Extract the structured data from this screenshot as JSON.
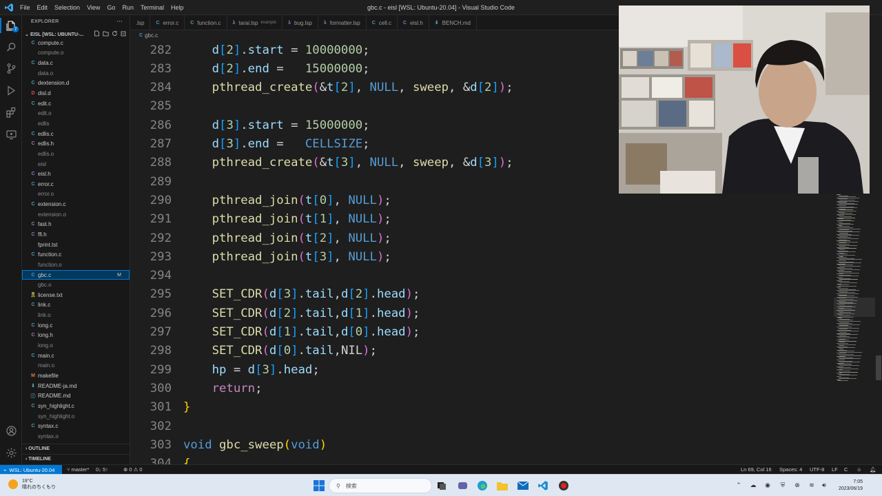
{
  "window": {
    "title": "gbc.c - eisl [WSL: Ubuntu-20.04] - Visual Studio Code",
    "menu": [
      "File",
      "Edit",
      "Selection",
      "View",
      "Go",
      "Run",
      "Terminal",
      "Help"
    ]
  },
  "activity": {
    "source_control_badge": "7"
  },
  "explorer": {
    "title": "EXPLORER",
    "more": "···",
    "folder": "EISL [WSL: UBUNTU-...",
    "files": [
      {
        "icon": "C",
        "name": "compute.c",
        "dim": false,
        "color": "#519aba"
      },
      {
        "icon": "",
        "name": "compute.o",
        "dim": true,
        "color": "#8b8b8b"
      },
      {
        "icon": "C",
        "name": "data.c",
        "dim": false,
        "color": "#519aba"
      },
      {
        "icon": "",
        "name": "data.o",
        "dim": true,
        "color": "#8b8b8b"
      },
      {
        "icon": "C",
        "name": "dextension.d",
        "dim": false,
        "color": "#519aba"
      },
      {
        "icon": "D",
        "name": "disl.d",
        "dim": false,
        "color": "#e04c4c"
      },
      {
        "icon": "C",
        "name": "edit.c",
        "dim": false,
        "color": "#519aba"
      },
      {
        "icon": "",
        "name": "edit.o",
        "dim": true,
        "color": "#8b8b8b"
      },
      {
        "icon": "",
        "name": "edlis",
        "dim": true,
        "color": "#8b8b8b"
      },
      {
        "icon": "C",
        "name": "edlis.c",
        "dim": false,
        "color": "#519aba"
      },
      {
        "icon": "C",
        "name": "edlis.h",
        "dim": false,
        "color": "#a074c4"
      },
      {
        "icon": "",
        "name": "edlis.o",
        "dim": true,
        "color": "#8b8b8b"
      },
      {
        "icon": "",
        "name": "eisl",
        "dim": true,
        "color": "#8b8b8b"
      },
      {
        "icon": "C",
        "name": "eisl.h",
        "dim": false,
        "color": "#a074c4"
      },
      {
        "icon": "C",
        "name": "error.c",
        "dim": false,
        "color": "#519aba"
      },
      {
        "icon": "",
        "name": "error.o",
        "dim": true,
        "color": "#8b8b8b"
      },
      {
        "icon": "C",
        "name": "extension.c",
        "dim": false,
        "color": "#519aba"
      },
      {
        "icon": "",
        "name": "extension.o",
        "dim": true,
        "color": "#8b8b8b"
      },
      {
        "icon": "C",
        "name": "fast.h",
        "dim": false,
        "color": "#a074c4"
      },
      {
        "icon": "C",
        "name": "ffi.h",
        "dim": false,
        "color": "#a074c4"
      },
      {
        "icon": "",
        "name": "fprint.tst",
        "dim": false,
        "color": "#8b8b8b"
      },
      {
        "icon": "C",
        "name": "function.c",
        "dim": false,
        "color": "#519aba"
      },
      {
        "icon": "",
        "name": "function.o",
        "dim": true,
        "color": "#8b8b8b"
      },
      {
        "icon": "C",
        "name": "gbc.c",
        "dim": false,
        "color": "#519aba",
        "selected": true,
        "status": "M"
      },
      {
        "icon": "",
        "name": "gbc.o",
        "dim": true,
        "color": "#8b8b8b"
      },
      {
        "icon": "🎗",
        "name": "license.txt",
        "dim": false,
        "color": "#cbcb41"
      },
      {
        "icon": "C",
        "name": "link.c",
        "dim": false,
        "color": "#519aba"
      },
      {
        "icon": "",
        "name": "link.o",
        "dim": true,
        "color": "#8b8b8b"
      },
      {
        "icon": "C",
        "name": "long.c",
        "dim": false,
        "color": "#519aba"
      },
      {
        "icon": "C",
        "name": "long.h",
        "dim": false,
        "color": "#a074c4"
      },
      {
        "icon": "",
        "name": "long.o",
        "dim": true,
        "color": "#8b8b8b"
      },
      {
        "icon": "C",
        "name": "main.c",
        "dim": false,
        "color": "#519aba"
      },
      {
        "icon": "",
        "name": "main.o",
        "dim": true,
        "color": "#8b8b8b"
      },
      {
        "icon": "M",
        "name": "makefile",
        "dim": false,
        "color": "#e37933"
      },
      {
        "icon": "⬇",
        "name": "README-ja.md",
        "dim": false,
        "color": "#519aba"
      },
      {
        "icon": "ⓘ",
        "name": "README.md",
        "dim": false,
        "color": "#519aba"
      },
      {
        "icon": "C",
        "name": "syn_highlight.c",
        "dim": false,
        "color": "#519aba"
      },
      {
        "icon": "",
        "name": "syn_highlight.o",
        "dim": true,
        "color": "#8b8b8b"
      },
      {
        "icon": "C",
        "name": "syntax.c",
        "dim": false,
        "color": "#519aba"
      },
      {
        "icon": "",
        "name": "syntax.o",
        "dim": true,
        "color": "#8b8b8b"
      }
    ],
    "outline": "OUTLINE",
    "timeline": "TIMELINE"
  },
  "tabs": [
    {
      "icon": "",
      "label": ".lsp",
      "hint": "",
      "color": "#9d9d9d"
    },
    {
      "icon": "C",
      "label": "error.c",
      "hint": "",
      "color": "#519aba"
    },
    {
      "icon": "C",
      "label": "function.c",
      "hint": "",
      "color": "#519aba"
    },
    {
      "icon": "λ",
      "label": "tarai.lsp",
      "hint": "example",
      "color": "#a074c4"
    },
    {
      "icon": "λ",
      "label": "bug.lsp",
      "hint": "",
      "color": "#a074c4"
    },
    {
      "icon": "λ",
      "label": "formatter.lsp",
      "hint": "",
      "color": "#a074c4"
    },
    {
      "icon": "C",
      "label": "cell.c",
      "hint": "",
      "color": "#519aba"
    },
    {
      "icon": "C",
      "label": "eisl.h",
      "hint": "",
      "color": "#a074c4"
    },
    {
      "icon": "⬇",
      "label": "BENCH.md",
      "hint": "",
      "color": "#519aba"
    }
  ],
  "breadcrumb": {
    "icon": "C",
    "file": "gbc.c"
  },
  "code": [
    {
      "n": "282",
      "tokens": [
        [
          "    ",
          "id"
        ],
        [
          "d",
          "var"
        ],
        [
          "[",
          "br2"
        ],
        [
          "2",
          "num"
        ],
        [
          "]",
          "br2"
        ],
        [
          ".",
          "op"
        ],
        [
          "start",
          "var"
        ],
        [
          " = ",
          "op"
        ],
        [
          "10000000",
          "num"
        ],
        [
          ";",
          "op"
        ]
      ]
    },
    {
      "n": "283",
      "tokens": [
        [
          "    ",
          "id"
        ],
        [
          "d",
          "var"
        ],
        [
          "[",
          "br2"
        ],
        [
          "2",
          "num"
        ],
        [
          "]",
          "br2"
        ],
        [
          ".",
          "op"
        ],
        [
          "end",
          "var"
        ],
        [
          " =   ",
          "op"
        ],
        [
          "15000000",
          "num"
        ],
        [
          ";",
          "op"
        ]
      ]
    },
    {
      "n": "284",
      "tokens": [
        [
          "    ",
          "id"
        ],
        [
          "pthread_create",
          "fn"
        ],
        [
          "(",
          "br1"
        ],
        [
          "&",
          "op"
        ],
        [
          "t",
          "var"
        ],
        [
          "[",
          "br2"
        ],
        [
          "2",
          "num"
        ],
        [
          "]",
          "br2"
        ],
        [
          ", ",
          "op"
        ],
        [
          "NULL",
          "con"
        ],
        [
          ", ",
          "op"
        ],
        [
          "sweep",
          "fn"
        ],
        [
          ", &",
          "op"
        ],
        [
          "d",
          "var"
        ],
        [
          "[",
          "br2"
        ],
        [
          "2",
          "num"
        ],
        [
          "]",
          "br2"
        ],
        [
          ")",
          "br1"
        ],
        [
          ";",
          "op"
        ]
      ]
    },
    {
      "n": "285",
      "tokens": []
    },
    {
      "n": "286",
      "tokens": [
        [
          "    ",
          "id"
        ],
        [
          "d",
          "var"
        ],
        [
          "[",
          "br2"
        ],
        [
          "3",
          "num"
        ],
        [
          "]",
          "br2"
        ],
        [
          ".",
          "op"
        ],
        [
          "start",
          "var"
        ],
        [
          " = ",
          "op"
        ],
        [
          "15000000",
          "num"
        ],
        [
          ";",
          "op"
        ]
      ]
    },
    {
      "n": "287",
      "tokens": [
        [
          "    ",
          "id"
        ],
        [
          "d",
          "var"
        ],
        [
          "[",
          "br2"
        ],
        [
          "3",
          "num"
        ],
        [
          "]",
          "br2"
        ],
        [
          ".",
          "op"
        ],
        [
          "end",
          "var"
        ],
        [
          " =   ",
          "op"
        ],
        [
          "CELLSIZE",
          "con"
        ],
        [
          ";",
          "op"
        ]
      ]
    },
    {
      "n": "288",
      "tokens": [
        [
          "    ",
          "id"
        ],
        [
          "pthread_create",
          "fn"
        ],
        [
          "(",
          "br1"
        ],
        [
          "&",
          "op"
        ],
        [
          "t",
          "var"
        ],
        [
          "[",
          "br2"
        ],
        [
          "3",
          "num"
        ],
        [
          "]",
          "br2"
        ],
        [
          ", ",
          "op"
        ],
        [
          "NULL",
          "con"
        ],
        [
          ", ",
          "op"
        ],
        [
          "sweep",
          "fn"
        ],
        [
          ", &",
          "op"
        ],
        [
          "d",
          "var"
        ],
        [
          "[",
          "br2"
        ],
        [
          "3",
          "num"
        ],
        [
          "]",
          "br2"
        ],
        [
          ")",
          "br1"
        ],
        [
          ";",
          "op"
        ]
      ]
    },
    {
      "n": "289",
      "tokens": []
    },
    {
      "n": "290",
      "tokens": [
        [
          "    ",
          "id"
        ],
        [
          "pthread_join",
          "fn"
        ],
        [
          "(",
          "br1"
        ],
        [
          "t",
          "var"
        ],
        [
          "[",
          "br2"
        ],
        [
          "0",
          "num"
        ],
        [
          "]",
          "br2"
        ],
        [
          ", ",
          "op"
        ],
        [
          "NULL",
          "con"
        ],
        [
          ")",
          "br1"
        ],
        [
          ";",
          "op"
        ]
      ]
    },
    {
      "n": "291",
      "tokens": [
        [
          "    ",
          "id"
        ],
        [
          "pthread_join",
          "fn"
        ],
        [
          "(",
          "br1"
        ],
        [
          "t",
          "var"
        ],
        [
          "[",
          "br2"
        ],
        [
          "1",
          "num"
        ],
        [
          "]",
          "br2"
        ],
        [
          ", ",
          "op"
        ],
        [
          "NULL",
          "con"
        ],
        [
          ")",
          "br1"
        ],
        [
          ";",
          "op"
        ]
      ]
    },
    {
      "n": "292",
      "tokens": [
        [
          "    ",
          "id"
        ],
        [
          "pthread_join",
          "fn"
        ],
        [
          "(",
          "br1"
        ],
        [
          "t",
          "var"
        ],
        [
          "[",
          "br2"
        ],
        [
          "2",
          "num"
        ],
        [
          "]",
          "br2"
        ],
        [
          ", ",
          "op"
        ],
        [
          "NULL",
          "con"
        ],
        [
          ")",
          "br1"
        ],
        [
          ";",
          "op"
        ]
      ]
    },
    {
      "n": "293",
      "tokens": [
        [
          "    ",
          "id"
        ],
        [
          "pthread_join",
          "fn"
        ],
        [
          "(",
          "br1"
        ],
        [
          "t",
          "var"
        ],
        [
          "[",
          "br2"
        ],
        [
          "3",
          "num"
        ],
        [
          "]",
          "br2"
        ],
        [
          ", ",
          "op"
        ],
        [
          "NULL",
          "con"
        ],
        [
          ")",
          "br1"
        ],
        [
          ";",
          "op"
        ]
      ]
    },
    {
      "n": "294",
      "tokens": []
    },
    {
      "n": "295",
      "tokens": [
        [
          "    ",
          "id"
        ],
        [
          "SET_CDR",
          "fn"
        ],
        [
          "(",
          "br1"
        ],
        [
          "d",
          "var"
        ],
        [
          "[",
          "br2"
        ],
        [
          "3",
          "num"
        ],
        [
          "]",
          "br2"
        ],
        [
          ".",
          "op"
        ],
        [
          "tail",
          "var"
        ],
        [
          ",",
          "op"
        ],
        [
          "d",
          "var"
        ],
        [
          "[",
          "br2"
        ],
        [
          "2",
          "num"
        ],
        [
          "]",
          "br2"
        ],
        [
          ".",
          "op"
        ],
        [
          "head",
          "var"
        ],
        [
          ")",
          "br1"
        ],
        [
          ";",
          "op"
        ]
      ]
    },
    {
      "n": "296",
      "tokens": [
        [
          "    ",
          "id"
        ],
        [
          "SET_CDR",
          "fn"
        ],
        [
          "(",
          "br1"
        ],
        [
          "d",
          "var"
        ],
        [
          "[",
          "br2"
        ],
        [
          "2",
          "num"
        ],
        [
          "]",
          "br2"
        ],
        [
          ".",
          "op"
        ],
        [
          "tail",
          "var"
        ],
        [
          ",",
          "op"
        ],
        [
          "d",
          "var"
        ],
        [
          "[",
          "br2"
        ],
        [
          "1",
          "num"
        ],
        [
          "]",
          "br2"
        ],
        [
          ".",
          "op"
        ],
        [
          "head",
          "var"
        ],
        [
          ")",
          "br1"
        ],
        [
          ";",
          "op"
        ]
      ]
    },
    {
      "n": "297",
      "tokens": [
        [
          "    ",
          "id"
        ],
        [
          "SET_CDR",
          "fn"
        ],
        [
          "(",
          "br1"
        ],
        [
          "d",
          "var"
        ],
        [
          "[",
          "br2"
        ],
        [
          "1",
          "num"
        ],
        [
          "]",
          "br2"
        ],
        [
          ".",
          "op"
        ],
        [
          "tail",
          "var"
        ],
        [
          ",",
          "op"
        ],
        [
          "d",
          "var"
        ],
        [
          "[",
          "br2"
        ],
        [
          "0",
          "num"
        ],
        [
          "]",
          "br2"
        ],
        [
          ".",
          "op"
        ],
        [
          "head",
          "var"
        ],
        [
          ")",
          "br1"
        ],
        [
          ";",
          "op"
        ]
      ]
    },
    {
      "n": "298",
      "tokens": [
        [
          "    ",
          "id"
        ],
        [
          "SET_CDR",
          "fn"
        ],
        [
          "(",
          "br1"
        ],
        [
          "d",
          "var"
        ],
        [
          "[",
          "br2"
        ],
        [
          "0",
          "num"
        ],
        [
          "]",
          "br2"
        ],
        [
          ".",
          "op"
        ],
        [
          "tail",
          "var"
        ],
        [
          ",",
          "op"
        ],
        [
          "NIL",
          "id"
        ],
        [
          ")",
          "br1"
        ],
        [
          ";",
          "op"
        ]
      ]
    },
    {
      "n": "299",
      "tokens": [
        [
          "    ",
          "id"
        ],
        [
          "hp",
          "var"
        ],
        [
          " = ",
          "op"
        ],
        [
          "d",
          "var"
        ],
        [
          "[",
          "br2"
        ],
        [
          "3",
          "num"
        ],
        [
          "]",
          "br2"
        ],
        [
          ".",
          "op"
        ],
        [
          "head",
          "var"
        ],
        [
          ";",
          "op"
        ]
      ]
    },
    {
      "n": "300",
      "tokens": [
        [
          "    ",
          "id"
        ],
        [
          "return",
          "ctl"
        ],
        [
          ";",
          "op"
        ]
      ]
    },
    {
      "n": "301",
      "tokens": [
        [
          "}",
          "br3"
        ]
      ]
    },
    {
      "n": "302",
      "tokens": []
    },
    {
      "n": "303",
      "tokens": [
        [
          "void",
          "kw"
        ],
        [
          " ",
          "id"
        ],
        [
          "gbc_sweep",
          "fn"
        ],
        [
          "(",
          "br3"
        ],
        [
          "void",
          "kw"
        ],
        [
          ")",
          "br3"
        ]
      ]
    },
    {
      "n": "304",
      "tokens": [
        [
          "{",
          "br3"
        ]
      ]
    }
  ],
  "status": {
    "remote": "WSL: Ubuntu-20.04",
    "branch": "master*",
    "sync": "0↓ 5↑",
    "problems": "⊗ 0 ⚠ 0",
    "position": "Ln 69, Col 16",
    "spaces": "Spaces: 4",
    "encoding": "UTF-8",
    "eol": "LF",
    "language": "C"
  },
  "taskbar": {
    "weather_temp": "19°C",
    "weather_desc": "晴れのちくもり",
    "search_placeholder": "検索",
    "time": "7:05",
    "date": "2023/06/19"
  }
}
